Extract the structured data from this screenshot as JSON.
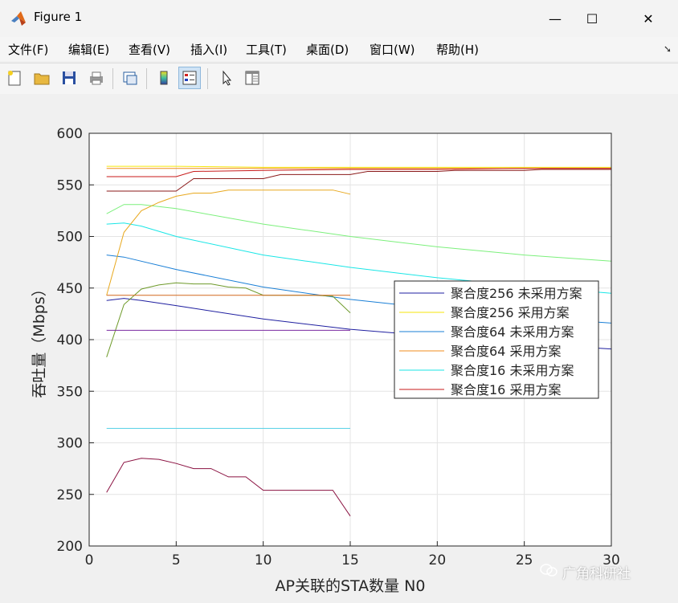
{
  "window": {
    "title": "Figure 1",
    "minimize": "—",
    "maximize": "☐",
    "close": "✕"
  },
  "menu": [
    "文件(F)",
    "编辑(E)",
    "查看(V)",
    "插入(I)",
    "工具(T)",
    "桌面(D)",
    "窗口(W)",
    "帮助(H)"
  ],
  "toolbar": [
    "new-figure-icon",
    "open-folder-icon",
    "save-icon",
    "print-icon",
    "link-icon",
    "colorbar-icon",
    "legend-icon",
    "pointer-icon",
    "property-editor-icon"
  ],
  "watermark": "广角科研社",
  "chart_data": {
    "type": "line",
    "title": "",
    "xlabel": "AP关联的STA数量 N0",
    "ylabel": "吞吐量（Mbps）",
    "xlim": [
      0,
      30
    ],
    "ylim": [
      200,
      600
    ],
    "xticks": [
      0,
      5,
      10,
      15,
      20,
      25,
      30
    ],
    "yticks": [
      200,
      250,
      300,
      350,
      400,
      450,
      500,
      550,
      600
    ],
    "grid": true,
    "legend_position": "center-right",
    "legend": [
      {
        "label": "聚合度256 未采用方案",
        "color": "#1f1fa0"
      },
      {
        "label": "聚合度256 采用方案",
        "color": "#f5e60a"
      },
      {
        "label": "聚合度64 未采用方案",
        "color": "#1a7fd6"
      },
      {
        "label": "聚合度64 采用方案",
        "color": "#f08c1e"
      },
      {
        "label": "聚合度16 未采用方案",
        "color": "#19e6e6"
      },
      {
        "label": "聚合度16 采用方案",
        "color": "#c81a1a"
      }
    ],
    "series": [
      {
        "color": "#1f1fa0",
        "x": [
          1,
          2,
          3,
          5,
          10,
          15,
          20,
          25,
          30
        ],
        "y": [
          438,
          440,
          438,
          433,
          420,
          410,
          403,
          396,
          391
        ]
      },
      {
        "color": "#f5e60a",
        "x": [
          1,
          5,
          10,
          15,
          20,
          25,
          30
        ],
        "y": [
          568,
          568,
          567,
          567,
          567,
          567,
          567
        ]
      },
      {
        "color": "#1a7fd6",
        "x": [
          1,
          2,
          5,
          10,
          15,
          20,
          25,
          30
        ],
        "y": [
          482,
          480,
          468,
          451,
          439,
          430,
          422,
          416
        ]
      },
      {
        "color": "#f08c1e",
        "x": [
          1,
          30
        ],
        "y": [
          566,
          566
        ]
      },
      {
        "color": "#19e6e6",
        "x": [
          1,
          2,
          3,
          5,
          10,
          15,
          20,
          25,
          30
        ],
        "y": [
          512,
          513,
          510,
          500,
          482,
          470,
          460,
          452,
          445
        ]
      },
      {
        "color": "#c81a1a",
        "x": [
          1,
          5,
          6,
          10,
          15,
          20,
          25,
          30
        ],
        "y": [
          558,
          558,
          563,
          564,
          565,
          565,
          566,
          566
        ]
      },
      {
        "color": "#8b1a1a",
        "x": [
          1,
          5,
          6,
          10,
          11,
          15,
          16,
          20,
          21,
          25,
          26,
          30
        ],
        "y": [
          544,
          544,
          556,
          556,
          560,
          560,
          563,
          563,
          564,
          564,
          565,
          565
        ]
      },
      {
        "color": "#7cf07c",
        "x": [
          1,
          2,
          3,
          5,
          10,
          15,
          20,
          25,
          30
        ],
        "y": [
          522,
          531,
          531,
          527,
          512,
          500,
          490,
          482,
          476
        ]
      },
      {
        "color": "#e8a81e",
        "x": [
          1,
          2,
          3,
          4,
          5,
          6,
          7,
          8,
          9,
          10,
          11,
          12,
          13,
          14,
          15
        ],
        "y": [
          443,
          504,
          525,
          533,
          539,
          542,
          542,
          545,
          545,
          545,
          545,
          545,
          545,
          545,
          541
        ]
      },
      {
        "color": "#6e9a2a",
        "x": [
          1,
          2,
          3,
          4,
          5,
          6,
          7,
          8,
          9,
          10,
          11,
          12,
          13,
          14,
          15
        ],
        "y": [
          383,
          434,
          449,
          453,
          455,
          454,
          454,
          451,
          450,
          443,
          443,
          443,
          443,
          442,
          426
        ]
      },
      {
        "color": "#d2691e",
        "x": [
          1,
          15
        ],
        "y": [
          443,
          443
        ]
      },
      {
        "color": "#7a2aa0",
        "x": [
          1,
          15
        ],
        "y": [
          409,
          409
        ]
      },
      {
        "color": "#5ad2e6",
        "x": [
          1,
          15
        ],
        "y": [
          314,
          314
        ]
      },
      {
        "color": "#8a1040",
        "x": [
          1,
          2,
          3,
          4,
          5,
          6,
          7,
          8,
          9,
          10,
          11,
          12,
          13,
          14,
          15
        ],
        "y": [
          252,
          281,
          285,
          284,
          280,
          275,
          275,
          267,
          267,
          254,
          254,
          254,
          254,
          254,
          229
        ]
      }
    ]
  }
}
